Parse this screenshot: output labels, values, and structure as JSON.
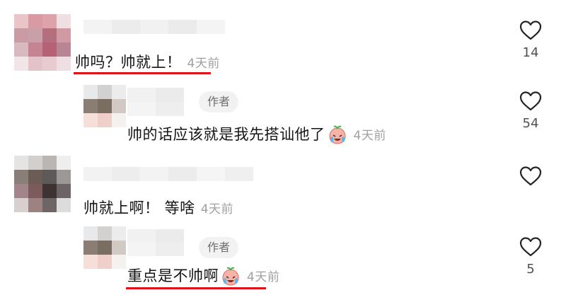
{
  "comments": [
    {
      "text": "帅吗？帅就上！",
      "time": "4天前",
      "likes": "14"
    },
    {
      "text": "帅的话应该就是我先搭讪他了",
      "time": "4天前",
      "likes": "54",
      "badge": "作者"
    },
    {
      "text": "帅就上啊！ 等啥",
      "time": "4天前",
      "likes": ""
    },
    {
      "text": "重点是不帅啊",
      "time": "4天前",
      "likes": "5",
      "badge": "作者"
    }
  ],
  "icons": {
    "like": "heart-outline-icon",
    "emoji": "crying-laugh-emoji-icon"
  },
  "colors": {
    "underline": "#e0111b",
    "time": "#a0a0a0",
    "badge_bg": "#f2f2f2"
  }
}
